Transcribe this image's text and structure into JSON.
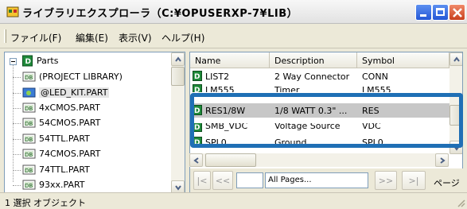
{
  "window": {
    "title": "ライブラリエクスプローラ（C:¥OPUSERXP-7¥LIB）"
  },
  "menu": {
    "items": [
      "ファイル(F)",
      "編集(E)",
      "表示(V)",
      "ヘルプ(H)"
    ]
  },
  "tree": {
    "root_label": "Parts",
    "items": [
      "(PROJECT LIBRARY)",
      "@LED_KIT.PART",
      "4xCMOS.PART",
      "54CMOS.PART",
      "54TTL.PART",
      "74CMOS.PART",
      "74TTL.PART",
      "93xx.PART"
    ],
    "selected_item": "@LED_KIT.PART"
  },
  "list": {
    "columns": [
      "Name",
      "Description",
      "Symbol"
    ],
    "rows": [
      {
        "name": "LIST2",
        "description": "2 Way Connector",
        "symbol": "CONN"
      },
      {
        "name": "LM555",
        "description": "Timer",
        "symbol": "LM555"
      },
      {
        "name": "RES1/8W",
        "description": "1/8 WATT 0.3\" ...",
        "symbol": "RES"
      },
      {
        "name": "SMB_VDC",
        "description": "Voltage Source",
        "symbol": "VDC"
      },
      {
        "name": "SPL0",
        "description": "Ground",
        "symbol": "SPL0"
      }
    ],
    "selected_row": "RES1/8W"
  },
  "pager": {
    "first_label": "|<",
    "prev_label": "<<",
    "pages_text": "All Pages...",
    "next_label": ">>",
    "last_label": ">|",
    "page_label": "ページ"
  },
  "status": {
    "text": "1 選択 オブジェクト"
  },
  "colors": {
    "highlight_border": "#1f6fb5",
    "selected_row": "#c7c7c7"
  }
}
